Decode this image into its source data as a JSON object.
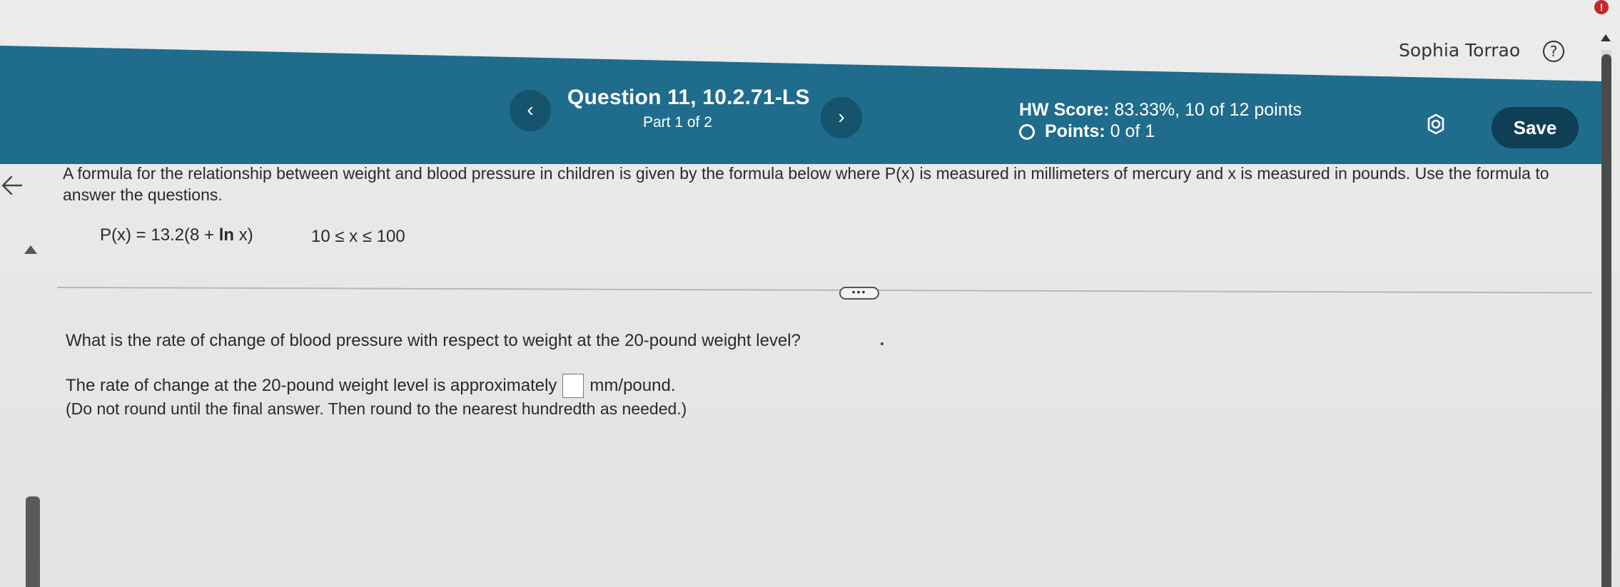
{
  "header": {
    "user_name": "Sophia Torrao",
    "help_symbol": "?",
    "question_title": "Question 11, 10.2.71-LS",
    "question_part": "Part 1 of 2",
    "hw_score_label": "HW Score:",
    "hw_score_value": "83.33%, 10 of 12 points",
    "points_label": "Points:",
    "points_value": "0 of 1",
    "save_label": "Save",
    "prev_symbol": "‹",
    "next_symbol": "›",
    "alert_symbol": "!"
  },
  "problem": {
    "intro": "A formula for the relationship between weight and blood pressure in children is given by the formula below where P(x) is measured in millimeters of mercury and x is measured in pounds. Use the formula to answer the questions.",
    "formula_prefix": "P(x) = 13.2(8 + ",
    "formula_ln": "ln",
    "formula_suffix": " x)",
    "domain": "10 ≤ x ≤ 100",
    "more_symbol": "•••",
    "question": "What is the rate of change of blood pressure with respect to weight at the 20-pound weight level?",
    "answer_prefix": "The rate of change at the 20-pound weight level is approximately",
    "answer_unit": "mm/pound.",
    "instruction": "(Do not round until the final answer. Then round to the nearest hundredth as needed.)"
  },
  "icons": {
    "back": "back-arrow-icon",
    "settings": "gear-icon",
    "help": "help-icon"
  },
  "colors": {
    "header_band": "#1f6c8d",
    "nav_button": "#16536d",
    "save_button": "#0f3f55",
    "alert": "#c62828"
  }
}
